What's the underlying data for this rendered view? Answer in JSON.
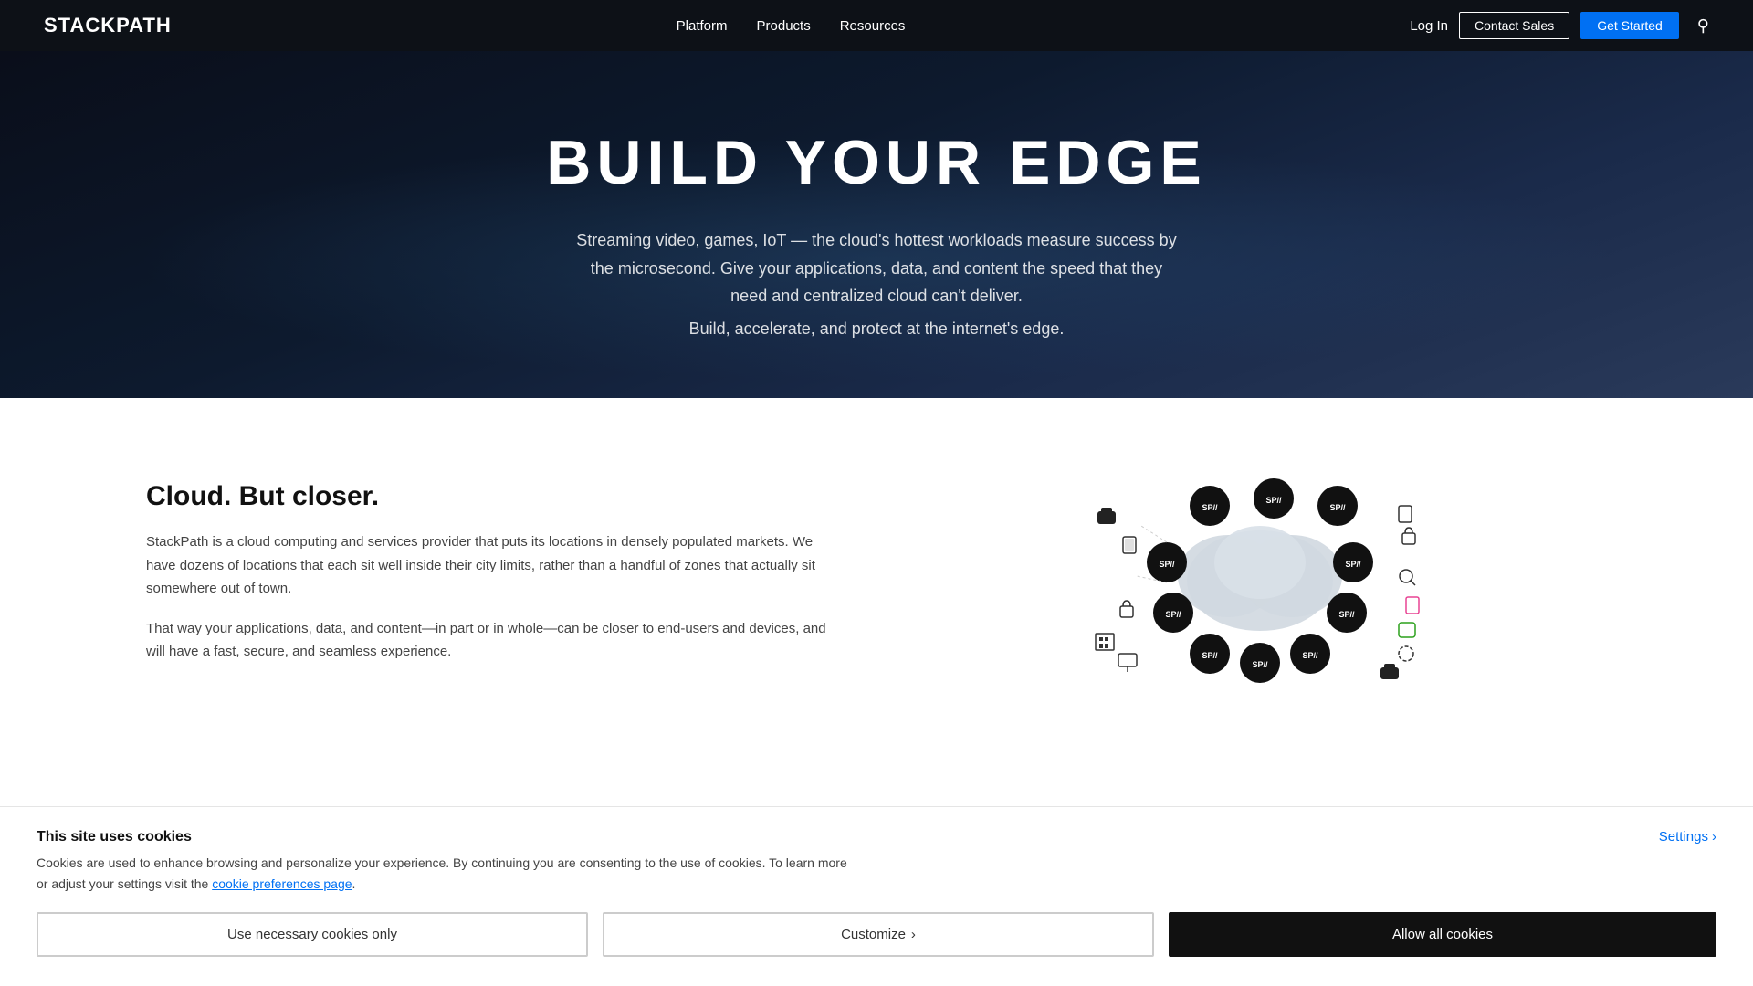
{
  "nav": {
    "logo": "STACKPATH",
    "links": [
      {
        "label": "Platform",
        "id": "platform"
      },
      {
        "label": "Products",
        "id": "products"
      },
      {
        "label": "Resources",
        "id": "resources"
      }
    ],
    "login_label": "Log In",
    "contact_label": "Contact Sales",
    "started_label": "Get Started"
  },
  "hero": {
    "title": "BUILD YOUR EDGE",
    "subtitle": "Streaming video, games, IoT — the cloud's hottest workloads measure success by the microsecond. Give your applications, data, and content the speed that they need and centralized cloud can't deliver.",
    "tagline": "Build, accelerate, and protect at the internet's edge."
  },
  "cloud_section": {
    "title": "Cloud. But closer.",
    "para1": "StackPath is a cloud computing and services provider that puts its locations in densely populated markets. We have dozens of locations that each sit well inside their city limits, rather than a handful of zones that actually sit somewhere out of town.",
    "para2": "That way your applications, data, and content—in part or in whole—can be closer to end-users and devices, and will have a fast, secure, and seamless experience."
  },
  "cookie": {
    "title": "This site uses cookies",
    "description": "Cookies are used to enhance browsing and personalize your experience. By continuing you are consenting to the use of cookies. To learn more or adjust your settings visit the cookie preferences page.",
    "settings_label": "Settings",
    "btn_necessary": "Use necessary cookies only",
    "btn_customize": "Customize",
    "btn_allow": "Allow all cookies"
  }
}
